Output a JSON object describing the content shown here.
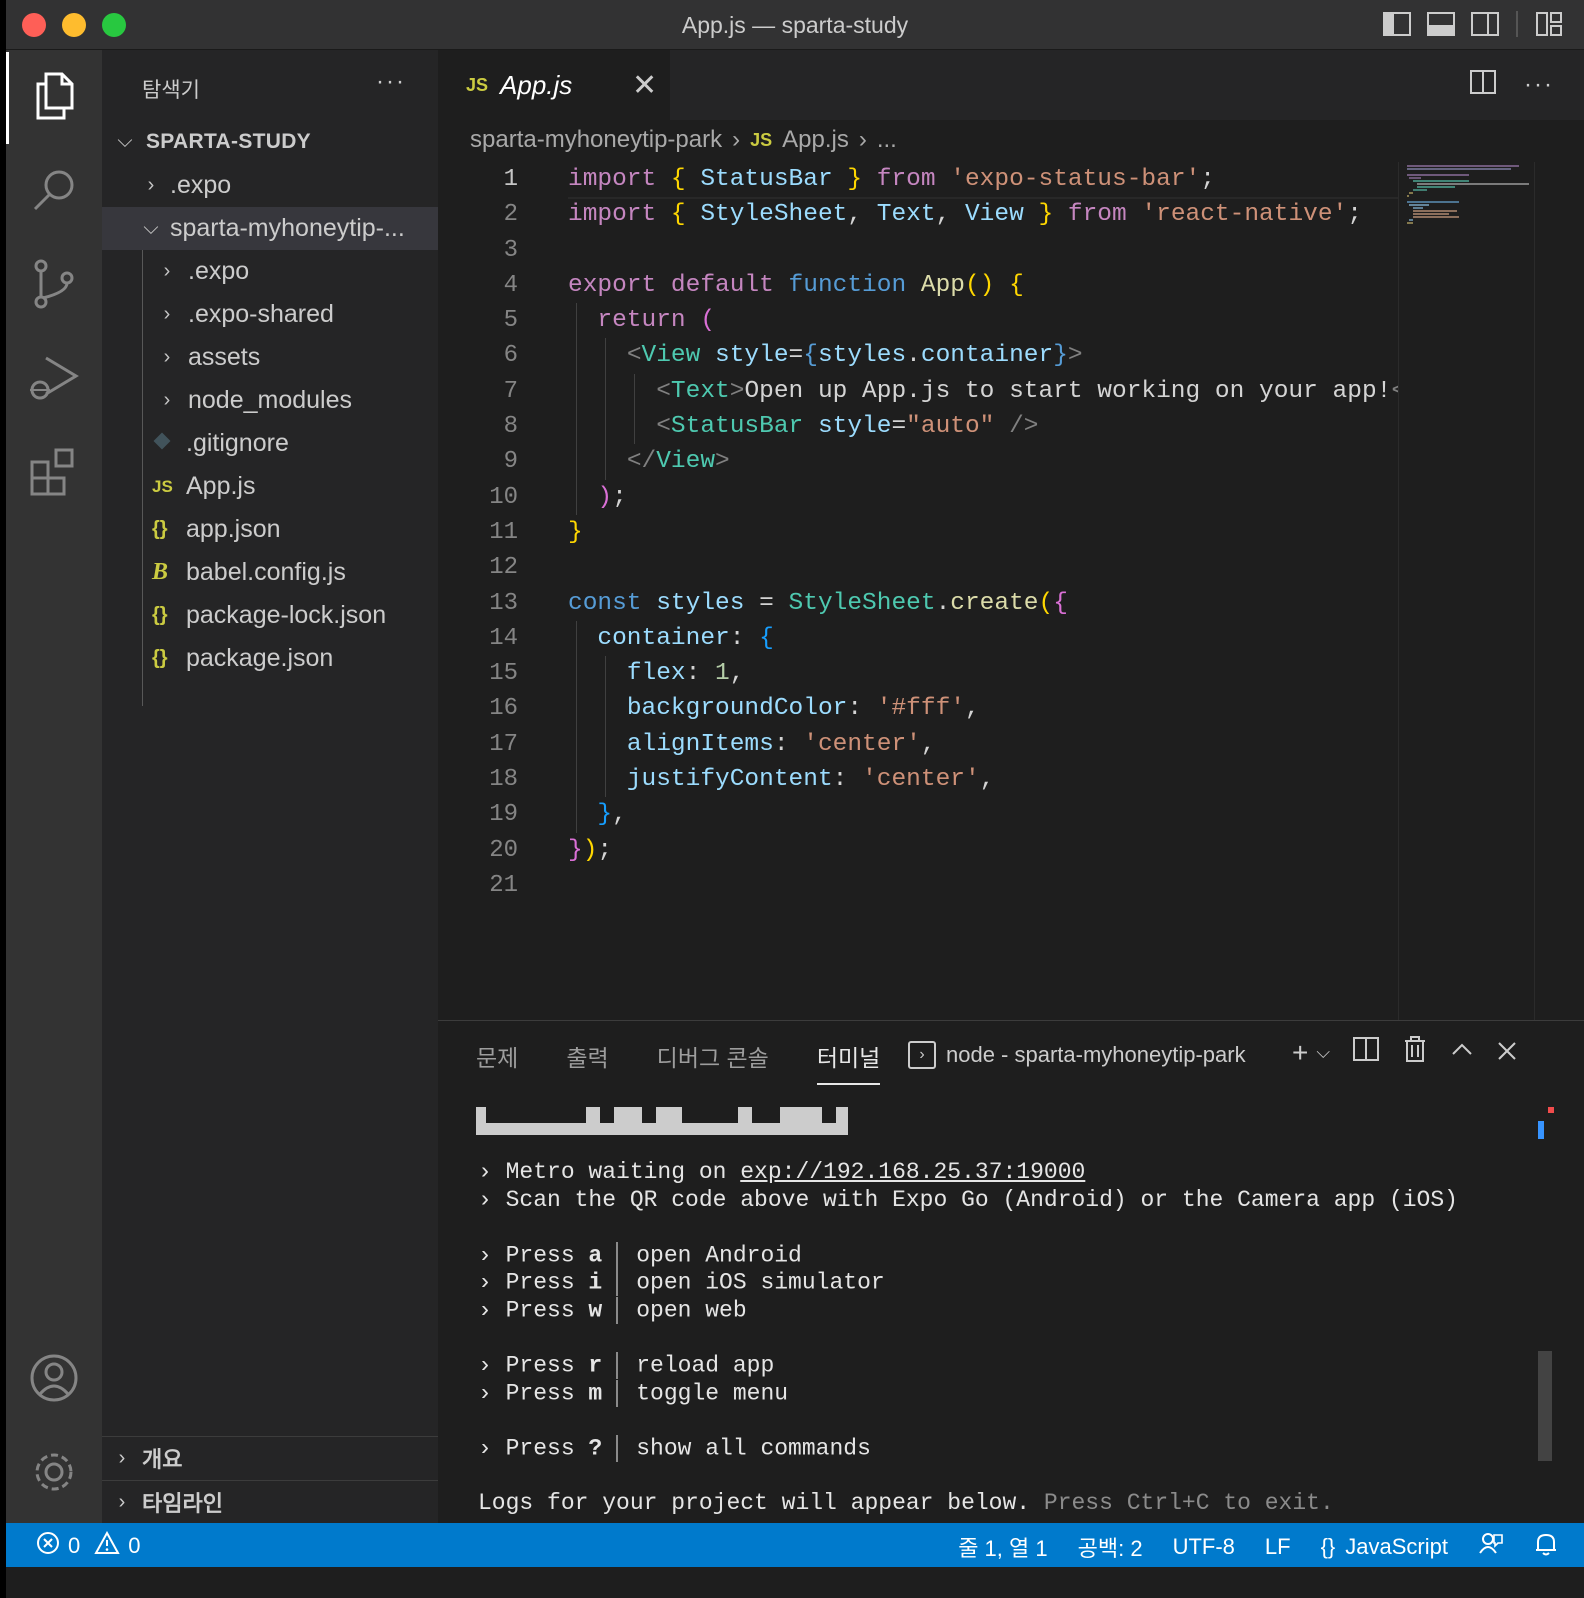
{
  "window": {
    "title": "App.js — sparta-study"
  },
  "sidebar": {
    "header": "탐색기",
    "more": "···",
    "root": "SPARTA-STUDY",
    "items": [
      {
        "label": ".expo",
        "type": "folder",
        "level": 1,
        "expanded": false
      },
      {
        "label": "sparta-myhoneytip-...",
        "type": "folder",
        "level": 1,
        "expanded": true,
        "selected": true
      },
      {
        "label": ".expo",
        "type": "folder",
        "level": 2,
        "expanded": false
      },
      {
        "label": ".expo-shared",
        "type": "folder",
        "level": 2,
        "expanded": false
      },
      {
        "label": "assets",
        "type": "folder",
        "level": 2,
        "expanded": false
      },
      {
        "label": "node_modules",
        "type": "folder",
        "level": 2,
        "expanded": false
      },
      {
        "label": ".gitignore",
        "type": "file",
        "icon": "git",
        "level": 2
      },
      {
        "label": "App.js",
        "type": "file",
        "icon": "js",
        "level": 2
      },
      {
        "label": "app.json",
        "type": "file",
        "icon": "json",
        "level": 2
      },
      {
        "label": "babel.config.js",
        "type": "file",
        "icon": "babel",
        "level": 2
      },
      {
        "label": "package-lock.json",
        "type": "file",
        "icon": "json",
        "level": 2
      },
      {
        "label": "package.json",
        "type": "file",
        "icon": "json",
        "level": 2
      }
    ],
    "outline_label": "개요",
    "timeline_label": "타임라인"
  },
  "editor": {
    "tab": {
      "icon_text": "JS",
      "label": "App.js",
      "close": "✕"
    },
    "breadcrumb": {
      "folder": "sparta-myhoneytip-park",
      "icon_text": "JS",
      "file": "App.js",
      "more": "..."
    },
    "line_numbers": [
      "1",
      "2",
      "3",
      "4",
      "5",
      "6",
      "7",
      "8",
      "9",
      "10",
      "11",
      "12",
      "13",
      "14",
      "15",
      "16",
      "17",
      "18",
      "19",
      "20",
      "21"
    ],
    "current_line": 1
  },
  "panel": {
    "tabs": [
      "문제",
      "출력",
      "디버그 콘솔",
      "터미널"
    ],
    "active_tab": "터미널",
    "terminal_name": "node - sparta-myhoneytip-park",
    "lines": {
      "metro_prefix": "› Metro waiting on ",
      "metro_url": "exp://192.168.25.37:19000",
      "scan": "› Scan the QR code above with Expo Go (Android) or the Camera app (iOS)",
      "press_a_key": "a",
      "press_a_desc": "open Android",
      "press_i_key": "i",
      "press_i_desc": "open iOS simulator",
      "press_w_key": "w",
      "press_w_desc": "open web",
      "press_r_key": "r",
      "press_r_desc": "reload app",
      "press_m_key": "m",
      "press_m_desc": "toggle menu",
      "press_q_key": "?",
      "press_q_desc": "show all commands",
      "press_prefix": "› Press ",
      "logs": "Logs for your project will appear below.",
      "logs_dim": " Press Ctrl+C to exit."
    }
  },
  "statusbar": {
    "errors": "0",
    "warnings": "0",
    "position": "줄 1, 열 1",
    "spaces": "공백: 2",
    "encoding": "UTF-8",
    "eol": "LF",
    "language": "JavaScript"
  },
  "colors": {
    "statusbar": "#007acc",
    "activitybar": "#333333",
    "sidebar": "#252526",
    "editor": "#1e1e1e",
    "js_icon": "#cbcb41"
  }
}
